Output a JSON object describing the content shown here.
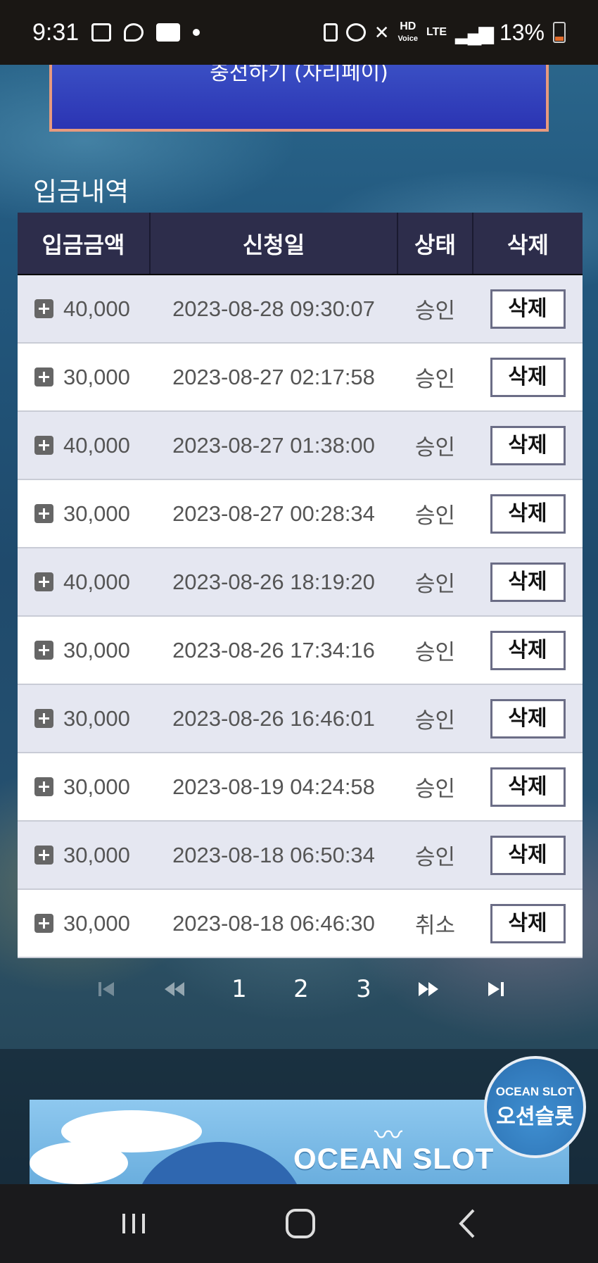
{
  "status_bar": {
    "time": "9:31",
    "network": "LTE",
    "hd_label": "HD",
    "voice_label": "Voice",
    "battery": "13%"
  },
  "top_button": {
    "label": "충전하기 (자리페이)"
  },
  "section": {
    "title": "입금내역"
  },
  "table": {
    "headers": [
      "입금금액",
      "신청일",
      "상태",
      "삭제"
    ],
    "rows": [
      {
        "amount": "40,000",
        "date": "2023-08-28 09:30:07",
        "status": "승인",
        "action": "삭제"
      },
      {
        "amount": "30,000",
        "date": "2023-08-27 02:17:58",
        "status": "승인",
        "action": "삭제"
      },
      {
        "amount": "40,000",
        "date": "2023-08-27 01:38:00",
        "status": "승인",
        "action": "삭제"
      },
      {
        "amount": "30,000",
        "date": "2023-08-27 00:28:34",
        "status": "승인",
        "action": "삭제"
      },
      {
        "amount": "40,000",
        "date": "2023-08-26 18:19:20",
        "status": "승인",
        "action": "삭제"
      },
      {
        "amount": "30,000",
        "date": "2023-08-26 17:34:16",
        "status": "승인",
        "action": "삭제"
      },
      {
        "amount": "30,000",
        "date": "2023-08-26 16:46:01",
        "status": "승인",
        "action": "삭제"
      },
      {
        "amount": "30,000",
        "date": "2023-08-19 04:24:58",
        "status": "승인",
        "action": "삭제"
      },
      {
        "amount": "30,000",
        "date": "2023-08-18 06:50:34",
        "status": "승인",
        "action": "삭제"
      },
      {
        "amount": "30,000",
        "date": "2023-08-18 06:46:30",
        "status": "취소",
        "action": "삭제"
      }
    ]
  },
  "pagination": {
    "pages": [
      "1",
      "2",
      "3"
    ],
    "icons": [
      "first-page-icon",
      "prev-page-icon",
      "next-page-icon",
      "last-page-icon"
    ]
  },
  "banner": {
    "text": "OCEAN SLOT"
  },
  "badge": {
    "line1": "OCEAN SLOT",
    "line2": "오션슬롯"
  },
  "nav_bar": {
    "icons": [
      "recent-apps-icon",
      "home-icon",
      "back-icon"
    ]
  }
}
